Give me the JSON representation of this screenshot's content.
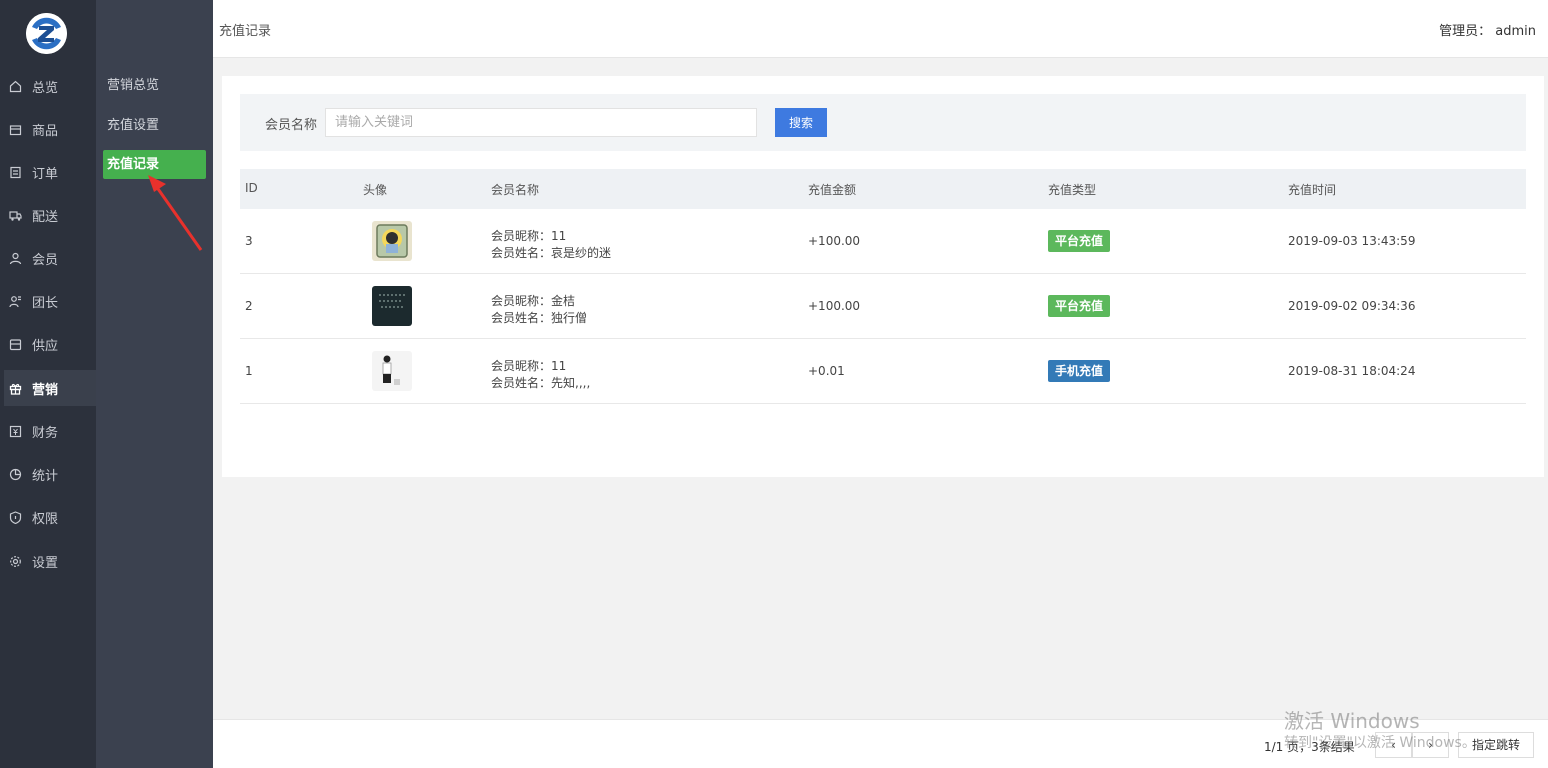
{
  "nav": {
    "items": [
      {
        "label": "总览",
        "icon": "home-icon"
      },
      {
        "label": "商品",
        "icon": "box-icon"
      },
      {
        "label": "订单",
        "icon": "order-icon"
      },
      {
        "label": "配送",
        "icon": "delivery-icon"
      },
      {
        "label": "会员",
        "icon": "user-icon"
      },
      {
        "label": "团长",
        "icon": "leader-icon"
      },
      {
        "label": "供应",
        "icon": "supply-icon"
      },
      {
        "label": "营销",
        "icon": "gift-icon"
      },
      {
        "label": "财务",
        "icon": "yen-icon"
      },
      {
        "label": "统计",
        "icon": "pie-chart-icon"
      },
      {
        "label": "权限",
        "icon": "shield-icon"
      },
      {
        "label": "设置",
        "icon": "gear-icon"
      }
    ],
    "active": "营销"
  },
  "subnav": {
    "items": [
      {
        "label": "营销总览"
      },
      {
        "label": "充值设置"
      },
      {
        "label": "充值记录"
      }
    ],
    "active": "充值记录"
  },
  "header": {
    "breadcrumb": "充值记录",
    "admin": "管理员： admin"
  },
  "search": {
    "label": "会员名称",
    "placeholder": "请输入关键词",
    "value": "",
    "button": "搜索"
  },
  "table": {
    "columns": [
      "ID",
      "头像",
      "会员名称",
      "充值金额",
      "充值类型",
      "充值时间"
    ],
    "rows": [
      {
        "id": "3",
        "nick": "会员昵称：11",
        "name": "会员姓名：哀是纱的迷",
        "amount": "+100.00",
        "type": "平台充值",
        "type_color": "#5cb85c",
        "time": "2019-09-03 13:43:59"
      },
      {
        "id": "2",
        "nick": "会员昵称：金桔",
        "name": "会员姓名：独行僧",
        "amount": "+100.00",
        "type": "平台充值",
        "type_color": "#5cb85c",
        "time": "2019-09-02 09:34:36"
      },
      {
        "id": "1",
        "nick": "会员昵称：11",
        "name": "会员姓名：先知,,,,",
        "amount": "+0.01",
        "type": "手机充值",
        "type_color": "#337ab7",
        "time": "2019-08-31 18:04:24"
      }
    ]
  },
  "pager": {
    "info": "1/1 页，3条结果",
    "prev": "‹",
    "next": "›",
    "jump": "指定跳转"
  },
  "watermark": {
    "line1": "激活 Windows",
    "line2": "转到\"设置\"以激活 Windows。"
  }
}
